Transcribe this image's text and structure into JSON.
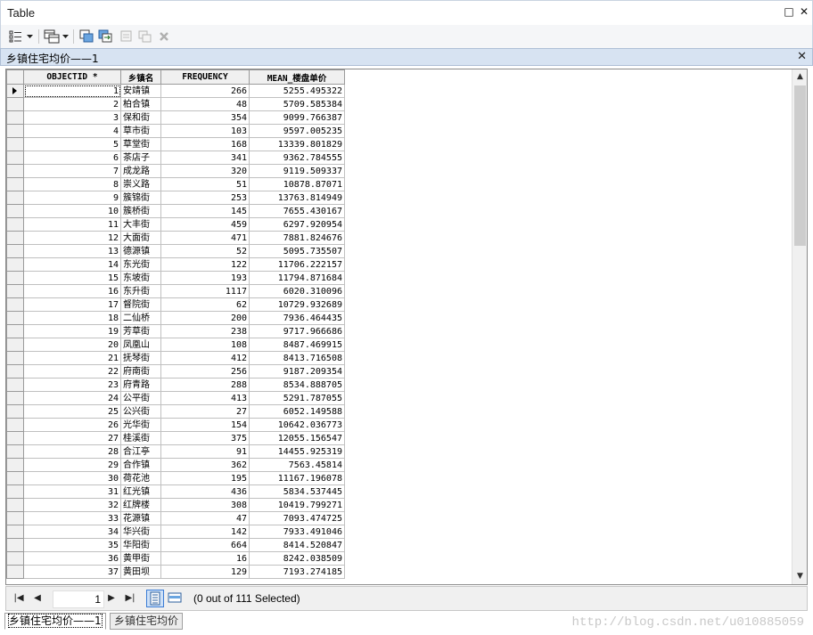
{
  "window": {
    "title": "Table",
    "restore_glyph": "□",
    "close_glyph": "✕"
  },
  "toolbar": {
    "icons": [
      "table-options-icon",
      "dropdown-arrow-icon",
      "related-tables-icon",
      "dropdown-arrow-icon",
      "select-by-attributes-icon",
      "switch-selection-icon",
      "clear-selection-icon",
      "zoom-to-selected-icon",
      "delete-selected-icon"
    ]
  },
  "table_tab": {
    "label": "乡镇住宅均价——1",
    "close_glyph": "✕"
  },
  "grid": {
    "columns": [
      "OBJECTID *",
      "乡镇名",
      "FREQUENCY",
      "MEAN_楼盘单价"
    ],
    "rows": [
      [
        "1",
        "安靖镇",
        "266",
        "5255.495322"
      ],
      [
        "2",
        "柏合镇",
        "48",
        "5709.585384"
      ],
      [
        "3",
        "保和街",
        "354",
        "9099.766387"
      ],
      [
        "4",
        "草市街",
        "103",
        "9597.005235"
      ],
      [
        "5",
        "草堂街",
        "168",
        "13339.801829"
      ],
      [
        "6",
        "茶店子",
        "341",
        "9362.784555"
      ],
      [
        "7",
        "成龙路",
        "320",
        "9119.509337"
      ],
      [
        "8",
        "崇义路",
        "51",
        "10878.87071"
      ],
      [
        "9",
        "簇锦街",
        "253",
        "13763.814949"
      ],
      [
        "10",
        "簇桥街",
        "145",
        "7655.430167"
      ],
      [
        "11",
        "大丰街",
        "459",
        "6297.920954"
      ],
      [
        "12",
        "大面街",
        "471",
        "7881.824676"
      ],
      [
        "13",
        "德源镇",
        "52",
        "5095.735507"
      ],
      [
        "14",
        "东光街",
        "122",
        "11706.222157"
      ],
      [
        "15",
        "东坡街",
        "193",
        "11794.871684"
      ],
      [
        "16",
        "东升街",
        "1117",
        "6020.310096"
      ],
      [
        "17",
        "督院街",
        "62",
        "10729.932689"
      ],
      [
        "18",
        "二仙桥",
        "200",
        "7936.464435"
      ],
      [
        "19",
        "芳草街",
        "238",
        "9717.966686"
      ],
      [
        "20",
        "凤凰山",
        "108",
        "8487.469915"
      ],
      [
        "21",
        "抚琴街",
        "412",
        "8413.716508"
      ],
      [
        "22",
        "府南街",
        "256",
        "9187.209354"
      ],
      [
        "23",
        "府青路",
        "288",
        "8534.888705"
      ],
      [
        "24",
        "公平街",
        "413",
        "5291.787055"
      ],
      [
        "25",
        "公兴街",
        "27",
        "6052.149588"
      ],
      [
        "26",
        "光华街",
        "154",
        "10642.036773"
      ],
      [
        "27",
        "桂溪街",
        "375",
        "12055.156547"
      ],
      [
        "28",
        "合江亭",
        "91",
        "14455.925319"
      ],
      [
        "29",
        "合作镇",
        "362",
        "7563.45814"
      ],
      [
        "30",
        "荷花池",
        "195",
        "11167.196078"
      ],
      [
        "31",
        "红光镇",
        "436",
        "5834.537445"
      ],
      [
        "32",
        "红牌楼",
        "308",
        "10419.799271"
      ],
      [
        "33",
        "花源镇",
        "47",
        "7093.474725"
      ],
      [
        "34",
        "华兴街",
        "142",
        "7933.491046"
      ],
      [
        "35",
        "华阳街",
        "664",
        "8414.520847"
      ],
      [
        "36",
        "黄甲街",
        "16",
        "8242.038509"
      ],
      [
        "37",
        "黄田坝",
        "129",
        "7193.274185"
      ]
    ]
  },
  "statusbar": {
    "record": "1",
    "selection_text": "(0 out of 111 Selected)"
  },
  "bottom_tabs": [
    {
      "label": "乡镇住宅均价——1",
      "active": true
    },
    {
      "label": "乡镇住宅均价",
      "active": false
    }
  ],
  "watermark": "http://blog.csdn.net/u010885059"
}
